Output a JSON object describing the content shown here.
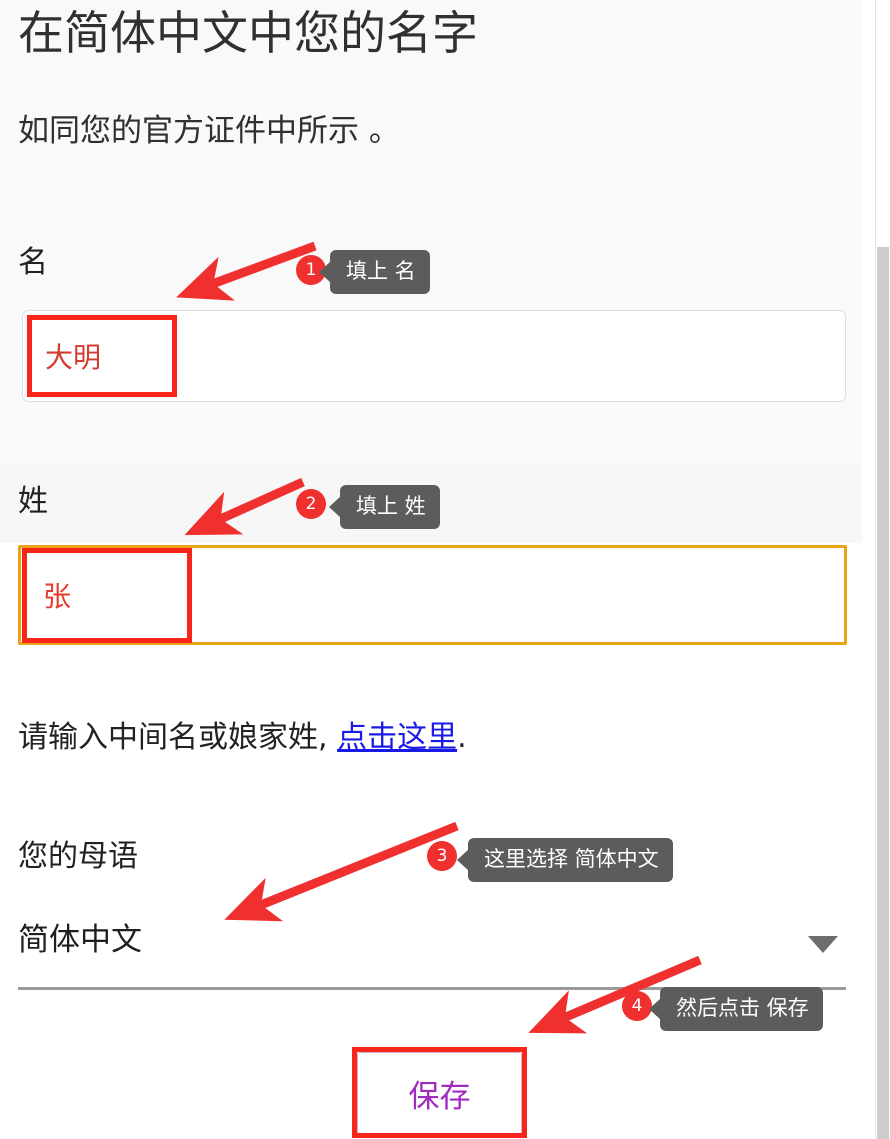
{
  "page": {
    "title": "在简体中文中您的名字",
    "subtitle": "如同您的官方证件中所示 。"
  },
  "form": {
    "first_name": {
      "label": "名",
      "value": "大明",
      "placeholder": ""
    },
    "last_name": {
      "label": "姓",
      "value": "张",
      "placeholder": ""
    },
    "hint": {
      "text_before": "请输入中间名或娘家姓, ",
      "link_text": "点击这里",
      "text_after": "."
    },
    "language": {
      "label": "您的母语",
      "selected": "简体中文",
      "caret_icon": "chevron-down-icon"
    },
    "save_button": {
      "label": "保存"
    }
  },
  "annotations": [
    {
      "number": "1",
      "text": "填上 名"
    },
    {
      "number": "2",
      "text": "填上 姓"
    },
    {
      "number": "3",
      "text": "这里选择 简体中文"
    },
    {
      "number": "4",
      "text": "然后点击 保存"
    }
  ],
  "colors": {
    "annotation_red": "#f02f2f",
    "tooltip_bg": "#5c5c5c",
    "input_value_red": "#e8392b",
    "focus_border_orange": "#e8a317",
    "link_blue": "#1a1ae6",
    "save_purple": "#a12ac0",
    "heading": "#303030"
  }
}
